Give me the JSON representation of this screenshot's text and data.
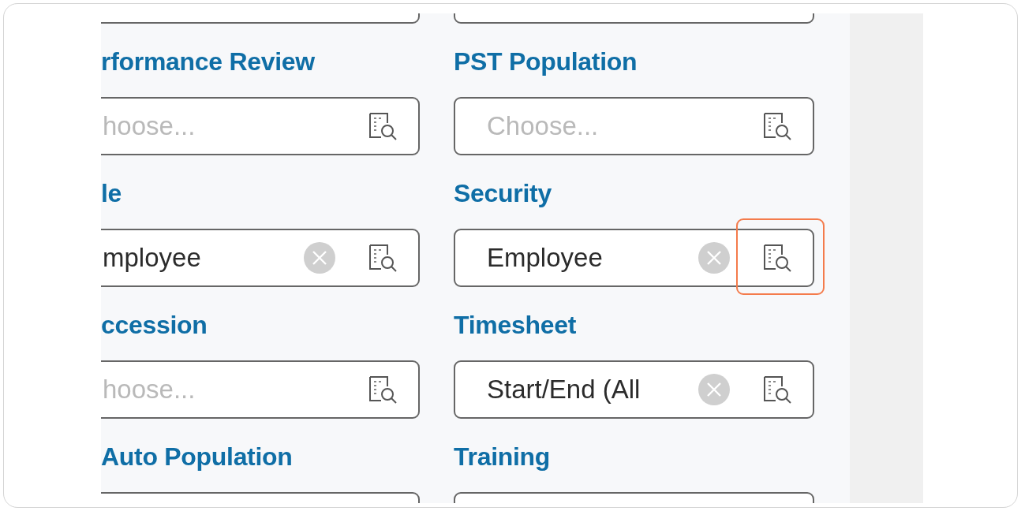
{
  "rows": [
    {
      "fields": [
        {
          "label": "rformance Review",
          "placeholder": "hoose...",
          "clearable": false,
          "highlighted": false
        },
        {
          "label": "PST Population",
          "placeholder": "Choose...",
          "clearable": false,
          "highlighted": false
        }
      ]
    },
    {
      "fields": [
        {
          "label": "le",
          "value": "mployee",
          "clearable": true,
          "highlighted": false
        },
        {
          "label": "Security",
          "value": "Employee",
          "clearable": true,
          "highlighted": true
        }
      ]
    },
    {
      "fields": [
        {
          "label": "ccession",
          "placeholder": "hoose...",
          "clearable": false,
          "highlighted": false
        },
        {
          "label": "Timesheet",
          "value": "Start/End (All",
          "clearable": true,
          "highlighted": false
        }
      ]
    },
    {
      "fields": [
        {
          "label": "Auto Population",
          "clearable": false,
          "highlighted": false,
          "lookup_visible": false
        },
        {
          "label": "Training",
          "clearable": false,
          "highlighted": false,
          "lookup_visible": false
        }
      ]
    }
  ]
}
